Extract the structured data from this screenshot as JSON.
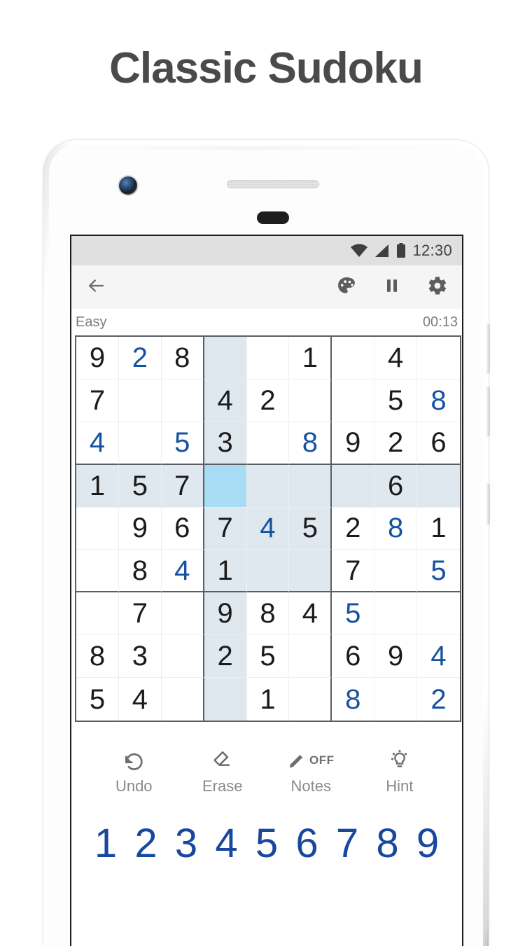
{
  "page": {
    "title": "Classic Sudoku"
  },
  "status_bar": {
    "time": "12:30",
    "icons": [
      "wifi-icon",
      "cellular-signal-icon",
      "battery-icon"
    ]
  },
  "toolbar": {
    "back_icon": "back-arrow-icon",
    "actions": [
      {
        "name": "theme-button",
        "icon": "palette-icon"
      },
      {
        "name": "pause-button",
        "icon": "pause-icon"
      },
      {
        "name": "settings-button",
        "icon": "gear-icon"
      }
    ]
  },
  "game_info": {
    "difficulty": "Easy",
    "timer": "00:13"
  },
  "board": {
    "selected_cell": {
      "row": 4,
      "col": 4
    },
    "colors": {
      "given": "#1b1b1b",
      "user": "#1352a2",
      "selected_bg": "#a8dcf5",
      "highlight_bg": "#dfe7ef",
      "grid_line": "#5b5f63"
    },
    "rows": [
      [
        {
          "v": "9",
          "u": false
        },
        {
          "v": "2",
          "u": true
        },
        {
          "v": "8",
          "u": false
        },
        {
          "v": "",
          "u": false
        },
        {
          "v": "",
          "u": false
        },
        {
          "v": "1",
          "u": false
        },
        {
          "v": "",
          "u": false
        },
        {
          "v": "4",
          "u": false
        },
        {
          "v": "",
          "u": false
        }
      ],
      [
        {
          "v": "7",
          "u": false
        },
        {
          "v": "",
          "u": false
        },
        {
          "v": "",
          "u": false
        },
        {
          "v": "4",
          "u": false
        },
        {
          "v": "2",
          "u": false
        },
        {
          "v": "",
          "u": false
        },
        {
          "v": "",
          "u": false
        },
        {
          "v": "5",
          "u": false
        },
        {
          "v": "8",
          "u": true
        }
      ],
      [
        {
          "v": "4",
          "u": true
        },
        {
          "v": "",
          "u": false
        },
        {
          "v": "5",
          "u": true
        },
        {
          "v": "3",
          "u": false
        },
        {
          "v": "",
          "u": false
        },
        {
          "v": "8",
          "u": true
        },
        {
          "v": "9",
          "u": false
        },
        {
          "v": "2",
          "u": false
        },
        {
          "v": "6",
          "u": false
        }
      ],
      [
        {
          "v": "1",
          "u": false
        },
        {
          "v": "5",
          "u": false
        },
        {
          "v": "7",
          "u": false
        },
        {
          "v": "",
          "u": false
        },
        {
          "v": "",
          "u": false
        },
        {
          "v": "",
          "u": false
        },
        {
          "v": "",
          "u": false
        },
        {
          "v": "6",
          "u": false
        },
        {
          "v": "",
          "u": false
        }
      ],
      [
        {
          "v": "",
          "u": false
        },
        {
          "v": "9",
          "u": false
        },
        {
          "v": "6",
          "u": false
        },
        {
          "v": "7",
          "u": false
        },
        {
          "v": "4",
          "u": true
        },
        {
          "v": "5",
          "u": false
        },
        {
          "v": "2",
          "u": false
        },
        {
          "v": "8",
          "u": true
        },
        {
          "v": "1",
          "u": false
        }
      ],
      [
        {
          "v": "",
          "u": false
        },
        {
          "v": "8",
          "u": false
        },
        {
          "v": "4",
          "u": true
        },
        {
          "v": "1",
          "u": false
        },
        {
          "v": "",
          "u": false
        },
        {
          "v": "",
          "u": false
        },
        {
          "v": "7",
          "u": false
        },
        {
          "v": "",
          "u": false
        },
        {
          "v": "5",
          "u": true
        }
      ],
      [
        {
          "v": "",
          "u": false
        },
        {
          "v": "7",
          "u": false
        },
        {
          "v": "",
          "u": false
        },
        {
          "v": "9",
          "u": false
        },
        {
          "v": "8",
          "u": false
        },
        {
          "v": "4",
          "u": false
        },
        {
          "v": "5",
          "u": true
        },
        {
          "v": "",
          "u": false
        },
        {
          "v": "",
          "u": false
        }
      ],
      [
        {
          "v": "8",
          "u": false
        },
        {
          "v": "3",
          "u": false
        },
        {
          "v": "",
          "u": false
        },
        {
          "v": "2",
          "u": false
        },
        {
          "v": "5",
          "u": false
        },
        {
          "v": "",
          "u": false
        },
        {
          "v": "6",
          "u": false
        },
        {
          "v": "9",
          "u": false
        },
        {
          "v": "4",
          "u": true
        }
      ],
      [
        {
          "v": "5",
          "u": false
        },
        {
          "v": "4",
          "u": false
        },
        {
          "v": "",
          "u": false
        },
        {
          "v": "",
          "u": false
        },
        {
          "v": "1",
          "u": false
        },
        {
          "v": "",
          "u": false
        },
        {
          "v": "8",
          "u": true
        },
        {
          "v": "",
          "u": false
        },
        {
          "v": "2",
          "u": true
        }
      ]
    ]
  },
  "actions": [
    {
      "name": "undo-button",
      "icon": "undo-icon",
      "label": "Undo",
      "state": ""
    },
    {
      "name": "erase-button",
      "icon": "eraser-icon",
      "label": "Erase",
      "state": ""
    },
    {
      "name": "notes-button",
      "icon": "pencil-icon",
      "label": "Notes",
      "state": "OFF"
    },
    {
      "name": "hint-button",
      "icon": "lightbulb-icon",
      "label": "Hint",
      "state": ""
    }
  ],
  "numpad": {
    "keys": [
      "1",
      "2",
      "3",
      "4",
      "5",
      "6",
      "7",
      "8",
      "9"
    ],
    "color": "#17479e"
  }
}
